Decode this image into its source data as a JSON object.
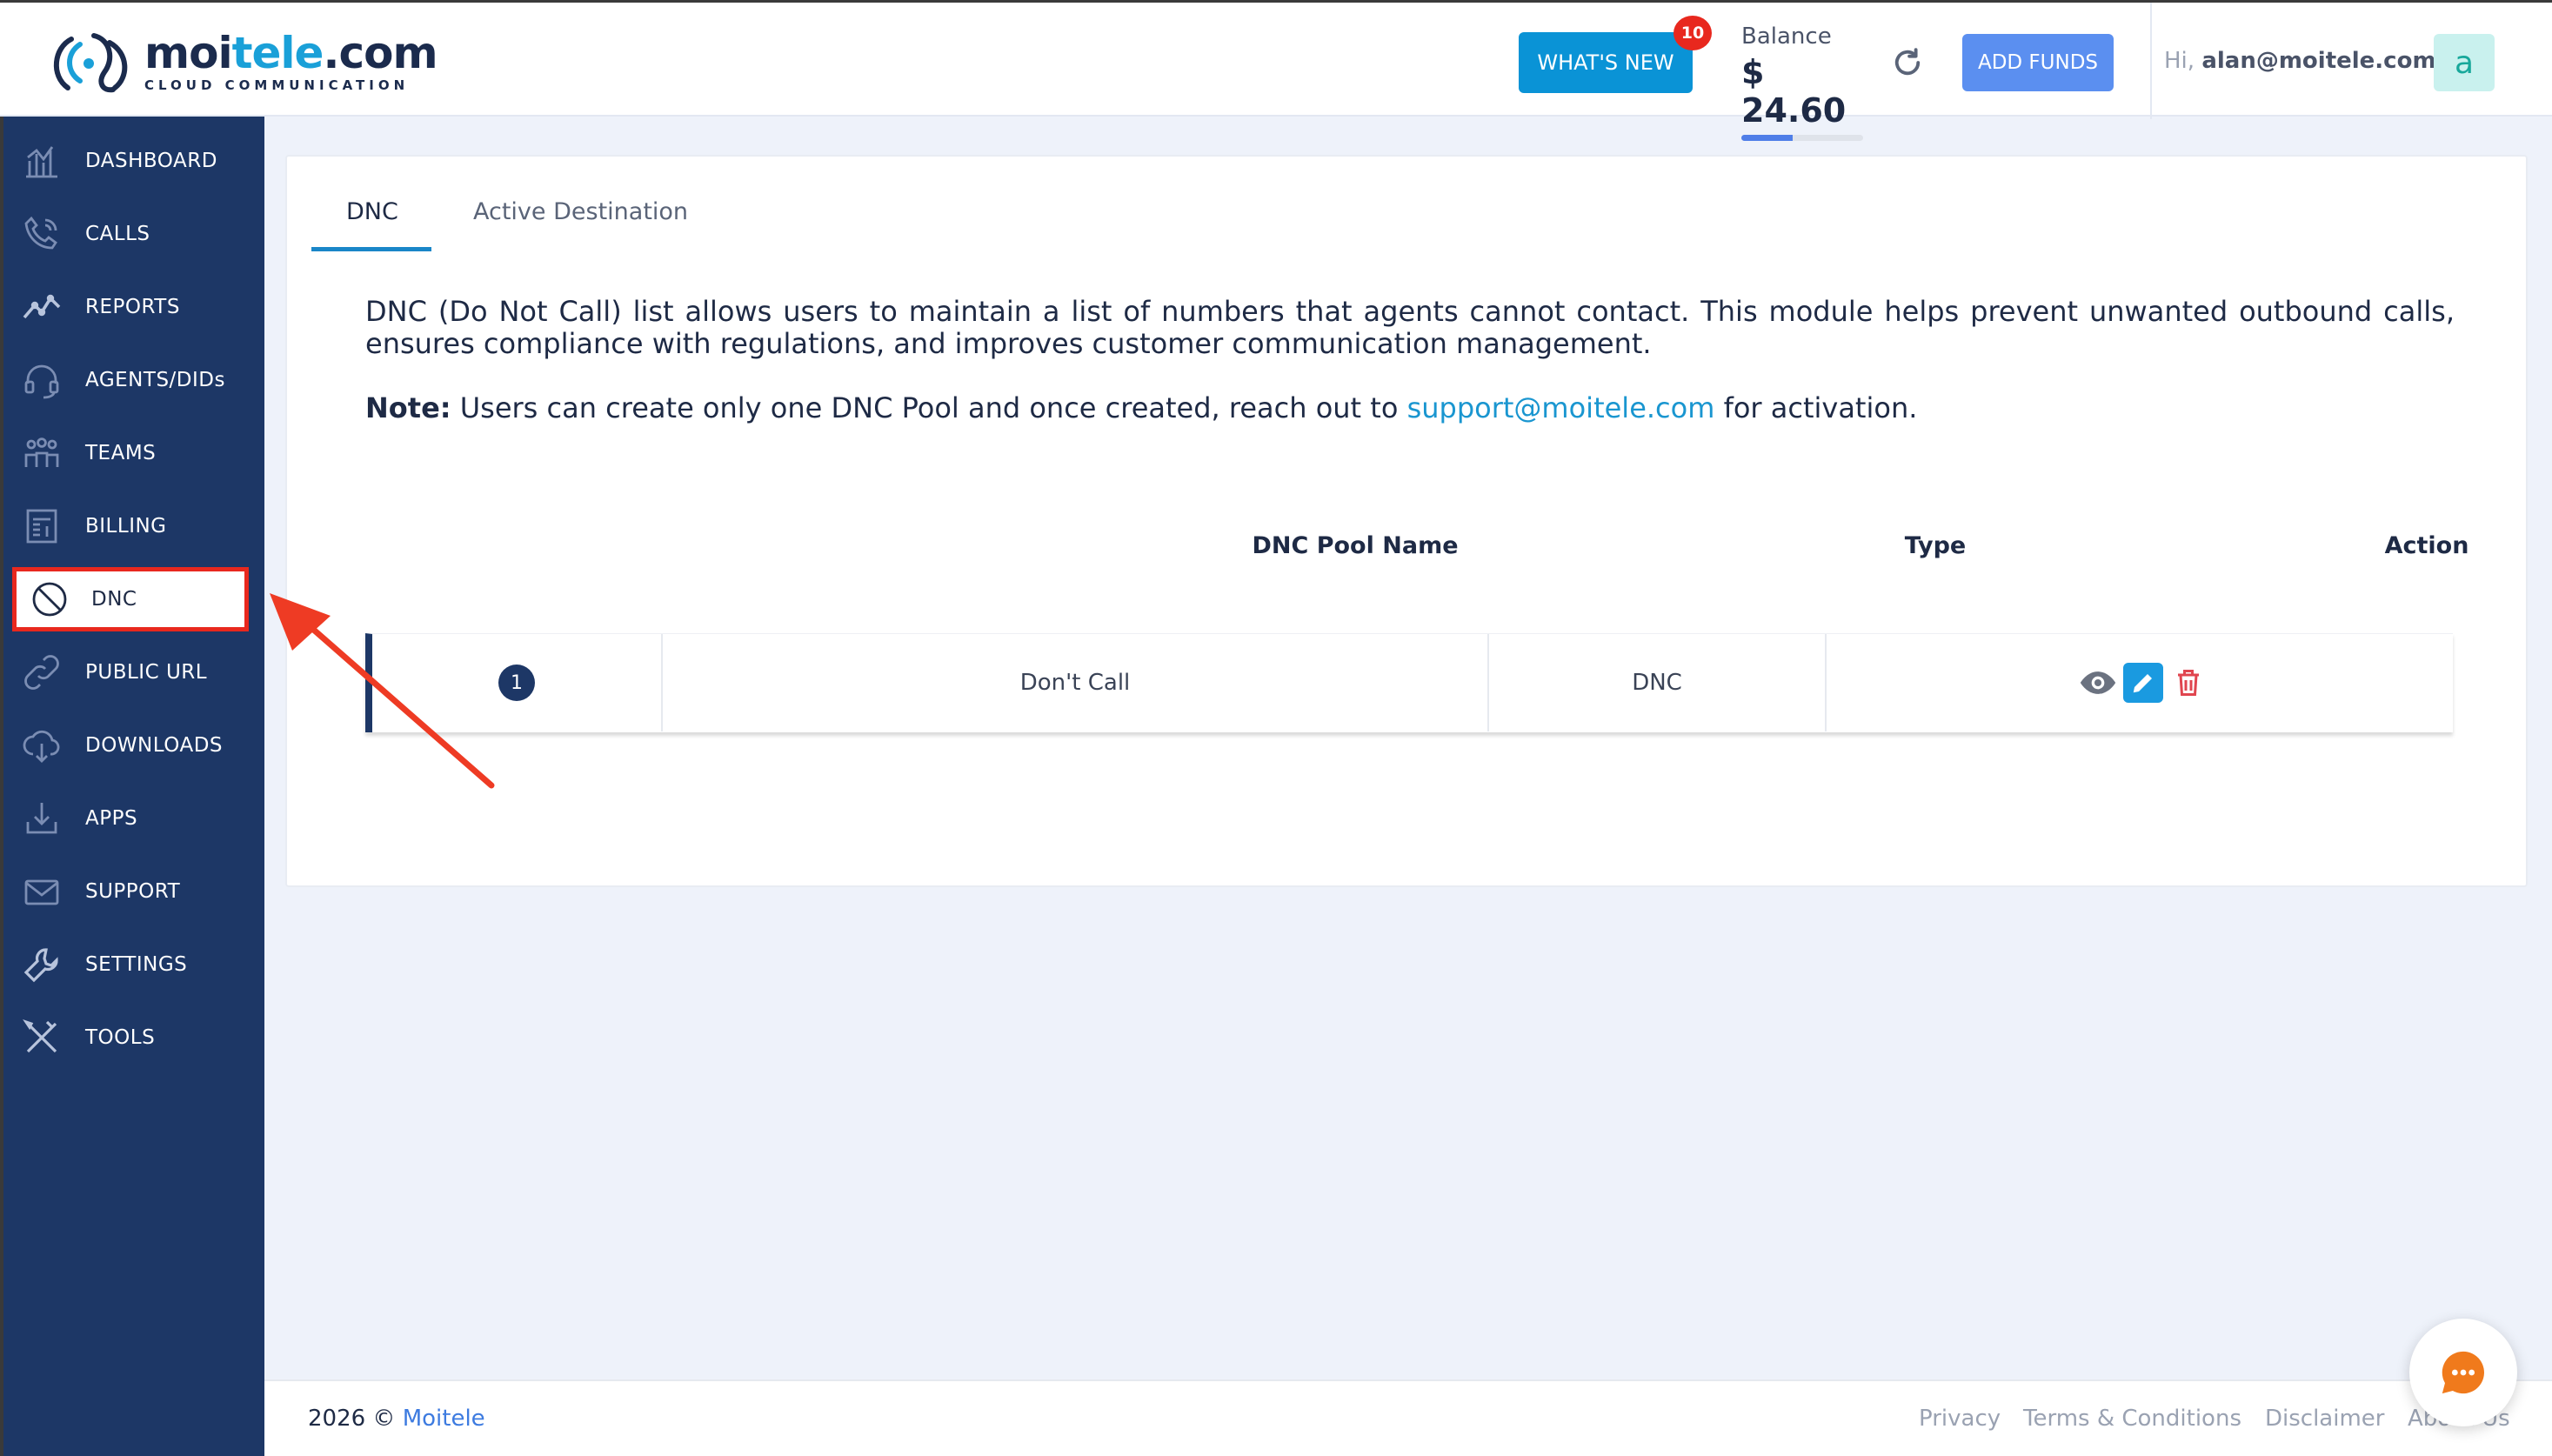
{
  "brand": {
    "name_part1": "moi",
    "name_part2": "tele",
    "name_part3": ".com",
    "tagline": "CLOUD COMMUNICATION"
  },
  "header": {
    "whats_new_label": "WHAT'S NEW",
    "whats_new_count": "10",
    "balance_label": "Balance",
    "balance_value": "$ 24.60",
    "add_funds_label": "ADD FUNDS",
    "greeting_prefix": "Hi,",
    "user_email": "alan@moitele.com",
    "avatar_initial": "a"
  },
  "sidebar": {
    "items": [
      {
        "label": "DASHBOARD",
        "icon": "dashboard-icon"
      },
      {
        "label": "CALLS",
        "icon": "phone-icon"
      },
      {
        "label": "REPORTS",
        "icon": "reports-icon"
      },
      {
        "label": "AGENTS/DIDs",
        "icon": "headset-icon"
      },
      {
        "label": "TEAMS",
        "icon": "teams-icon"
      },
      {
        "label": "BILLING",
        "icon": "billing-icon"
      },
      {
        "label": "DNC",
        "icon": "block-icon",
        "active": true
      },
      {
        "label": "PUBLIC URL",
        "icon": "link-icon"
      },
      {
        "label": "DOWNLOADS",
        "icon": "cloud-download-icon"
      },
      {
        "label": "APPS",
        "icon": "download-tray-icon"
      },
      {
        "label": "SUPPORT",
        "icon": "mail-icon"
      },
      {
        "label": "SETTINGS",
        "icon": "wrench-icon"
      },
      {
        "label": "TOOLS",
        "icon": "tools-icon"
      }
    ]
  },
  "main": {
    "tabs": [
      {
        "label": "DNC",
        "active": true
      },
      {
        "label": "Active Destination",
        "active": false
      }
    ],
    "description": "DNC (Do Not Call) list allows users to maintain a list of numbers that agents cannot contact. This module helps prevent unwanted outbound calls, ensures compliance with regulations, and improves customer communication management.",
    "note_label": "Note:",
    "note_text": " Users can create only one DNC Pool and once created, reach out to ",
    "note_email": "support@moitele.com",
    "note_suffix": " for activation.",
    "table": {
      "columns": [
        "DNC Pool Name",
        "Type",
        "Action"
      ],
      "rows": [
        {
          "index": "1",
          "name": "Don't Call",
          "type": "DNC"
        }
      ]
    }
  },
  "footer": {
    "year": "2026 ©",
    "company": "Moitele",
    "links": [
      "Privacy",
      "Terms & Conditions",
      "Disclaimer",
      "About Us"
    ]
  },
  "colors": {
    "sidebar_bg": "#1d3766",
    "primary_blue": "#0a93d6",
    "add_funds_blue": "#5b8ff0",
    "highlight_red": "#e8281e",
    "delete_red": "#e0454f"
  },
  "balance_fill_fraction": 0.42
}
